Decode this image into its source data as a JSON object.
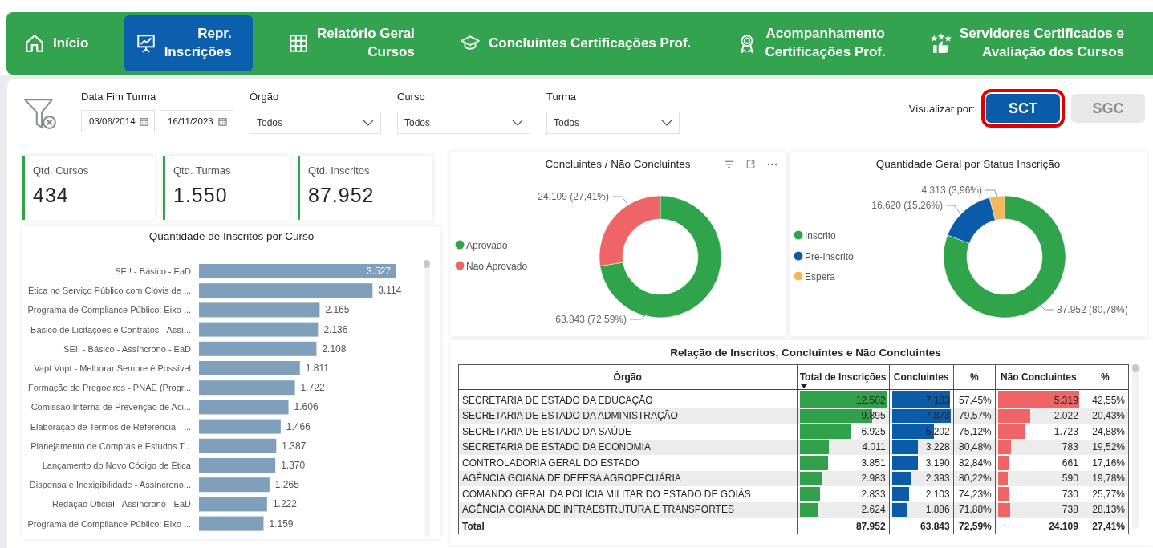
{
  "nav": [
    {
      "label": "Início",
      "selected": false
    },
    {
      "label": "Repr.\nInscrições",
      "selected": true
    },
    {
      "label": "Relatório Geral\nCursos",
      "selected": false
    },
    {
      "label": "Concluintes Certificações Prof.",
      "selected": false
    },
    {
      "label": "Acompanhamento\nCertificações Prof.",
      "selected": false
    },
    {
      "label": "Servidores Certificados e\nAvaliação dos Cursos",
      "selected": false
    }
  ],
  "filters": {
    "date": {
      "label": "Data Fim Turma",
      "from": "03/06/2014",
      "to": "16/11/2023"
    },
    "dropdowns": [
      {
        "label": "Órgão",
        "value": "Todos"
      },
      {
        "label": "Curso",
        "value": "Todos"
      },
      {
        "label": "Turma",
        "value": "Todos"
      }
    ]
  },
  "view_by": {
    "label": "Visualizar por:",
    "options": [
      {
        "label": "SCT",
        "selected": true
      },
      {
        "label": "SGC",
        "selected": false
      }
    ]
  },
  "kpis": [
    {
      "label": "Qtd. Cursos",
      "value": "434"
    },
    {
      "label": "Qtd. Turmas",
      "value": "1.550"
    },
    {
      "label": "Qtd. Inscritos",
      "value": "87.952"
    }
  ],
  "bar_chart": {
    "chart_data": {
      "type": "bar",
      "orientation": "horizontal",
      "title": "Quantidade de Inscritos por Curso",
      "data_labels": true,
      "categories": [
        "SEI! - Básico - EaD",
        "Ética no Serviço Público com Clóvis de ...",
        "Programa de Compliance Público: Eixo ...",
        "Básico de Licitações e Contratos - Assí...",
        "SEI! - Básico - Assíncrono - EaD",
        "Vapt Vupt - Melhorar Sempre é Possível",
        "Formação de Pregoeiros - PNAE (Progr...",
        "Comissão Interna de Prevenção de Aci...",
        "Elaboração de Termos de Referência - ...",
        "Planejamento de Compras e Estudos T...",
        "Lançamento do Novo Código de Ética",
        "Dispensa e Inexigibilidade - Assíncrono...",
        "Redação Oficial - Assíncrono - EaD",
        "Programa de Compliance Público: Eixo ..."
      ],
      "values": [
        3527,
        3114,
        2165,
        2136,
        2108,
        1811,
        1722,
        1606,
        1466,
        1387,
        1370,
        1265,
        1222,
        1159
      ],
      "value_labels": [
        "3.527",
        "3.114",
        "2.165",
        "2.136",
        "2.108",
        "1.811",
        "1.722",
        "1.606",
        "1.466",
        "1.387",
        "1.370",
        "1.265",
        "1.222",
        "1.159"
      ]
    }
  },
  "donuts": [
    {
      "chart_data": {
        "type": "donut",
        "title": "Concluintes / Não Concluintes",
        "legend": "left",
        "categories": [
          "Aprovado",
          "Nao Aprovado"
        ],
        "colors": [
          "#2fa44a",
          "#ee6467"
        ],
        "values": [
          63843,
          24109
        ],
        "value_labels": [
          "63.843 (72,59%)",
          "24.109 (27,41%)"
        ]
      }
    },
    {
      "chart_data": {
        "type": "donut",
        "title": "Quantidade Geral por Status Inscrição",
        "legend": "left",
        "categories": [
          "Inscrito",
          "Pre-inscrito",
          "Espera"
        ],
        "colors": [
          "#2fa44a",
          "#0a5ca8",
          "#f5b75b"
        ],
        "values": [
          87952,
          16620,
          4313
        ],
        "value_labels": [
          "87.952 (80,78%)",
          "16.620 (15,26%)",
          "4.313 (3,96%)"
        ]
      }
    }
  ],
  "table": {
    "title": "Relação de Inscritos, Concluintes e Não Concluintes",
    "columns": [
      {
        "label": "Órgão",
        "sorted": false
      },
      {
        "label": "Total de Inscrições",
        "sorted": true
      },
      {
        "label": "Concluintes",
        "sorted": false
      },
      {
        "label": "%",
        "sorted": false
      },
      {
        "label": "Não Concluintes",
        "sorted": false
      },
      {
        "label": "%",
        "sorted": false
      }
    ],
    "rows": [
      {
        "orgao": "SECRETARIA DE ESTADO DA EDUCAÇÃO",
        "total": {
          "text": "12.502",
          "level": 1
        },
        "concluintes": {
          "text": "7.183",
          "level": 0.912
        },
        "pct": "57,45%",
        "nao": {
          "text": "5.319",
          "level": 1
        },
        "pct_nao": "42,55%"
      },
      {
        "orgao": "SECRETARIA DE ESTADO DA ADMINISTRAÇÃO",
        "total": {
          "text": "9.895",
          "level": 0.79
        },
        "concluintes": {
          "text": "7.873",
          "level": 1
        },
        "pct": "79,57%",
        "nao": {
          "text": "2.022",
          "level": 0.38
        },
        "pct_nao": "20,43%"
      },
      {
        "orgao": "SECRETARIA DE ESTADO DA SAÚDE",
        "total": {
          "text": "6.925",
          "level": 0.554
        },
        "concluintes": {
          "text": "5.202",
          "level": 0.661
        },
        "pct": "75,12%",
        "nao": {
          "text": "1.723",
          "level": 0.324
        },
        "pct_nao": "24,88%"
      },
      {
        "orgao": "SECRETARIA DE ESTADO DA ECONOMIA",
        "total": {
          "text": "4.011",
          "level": 0.321
        },
        "concluintes": {
          "text": "3.228",
          "level": 0.41
        },
        "pct": "80,48%",
        "nao": {
          "text": "783",
          "level": 0.147
        },
        "pct_nao": "19,52%"
      },
      {
        "orgao": "CONTROLADORIA GERAL DO ESTADO",
        "total": {
          "text": "3.851",
          "level": 0.308
        },
        "concluintes": {
          "text": "3.190",
          "level": 0.405
        },
        "pct": "82,84%",
        "nao": {
          "text": "661",
          "level": 0.124
        },
        "pct_nao": "17,16%"
      },
      {
        "orgao": "AGÊNCIA GOIANA DE DEFESA AGROPECUÁRIA",
        "total": {
          "text": "2.983",
          "level": 0.239
        },
        "concluintes": {
          "text": "2.393",
          "level": 0.304
        },
        "pct": "80,22%",
        "nao": {
          "text": "590",
          "level": 0.111
        },
        "pct_nao": "19,78%"
      },
      {
        "orgao": "COMANDO GERAL DA POLÍCIA MILITAR DO ESTADO DE GOIÁS",
        "total": {
          "text": "2.833",
          "level": 0.227
        },
        "concluintes": {
          "text": "2.103",
          "level": 0.267
        },
        "pct": "74,23%",
        "nao": {
          "text": "730",
          "level": 0.137
        },
        "pct_nao": "25,77%"
      },
      {
        "orgao": "AGÊNCIA GOIANA DE INFRAESTRUTURA E TRANSPORTES",
        "total": {
          "text": "2.624",
          "level": 0.21
        },
        "concluintes": {
          "text": "1.886",
          "level": 0.24
        },
        "pct": "71,88%",
        "nao": {
          "text": "738",
          "level": 0.139
        },
        "pct_nao": "28,13%"
      }
    ],
    "total": {
      "label": "Total",
      "total": "87.952",
      "concluintes": "63.843",
      "pct": "72,59%",
      "nao": "24.109",
      "pct_nao": "27,41%"
    }
  }
}
